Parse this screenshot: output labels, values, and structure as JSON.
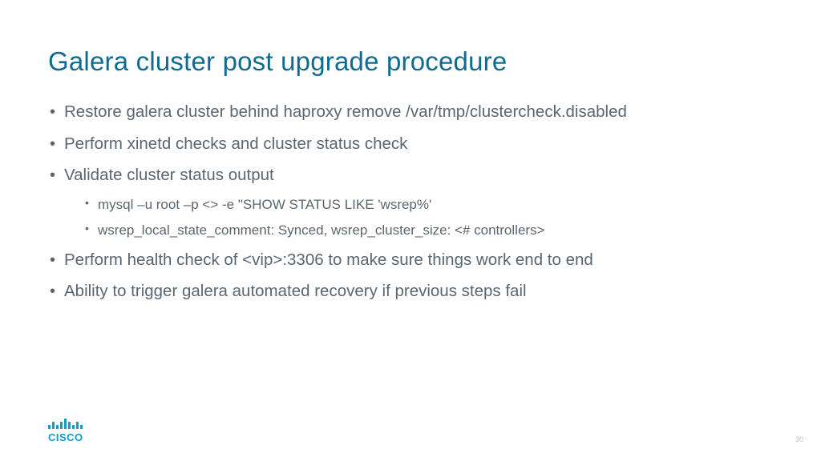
{
  "title": "Galera cluster post upgrade procedure",
  "bullets": {
    "b0": "Restore galera cluster behind haproxy remove /var/tmp/clustercheck.disabled",
    "b1": "Perform xinetd checks and cluster status check",
    "b2": "Validate cluster status output",
    "b2_sub0": "mysql –u root –p <> -e \"SHOW STATUS LIKE 'wsrep%'",
    "b2_sub1": "wsrep_local_state_comment: Synced, wsrep_cluster_size: <# controllers>",
    "b3": "Perform health check of <vip>:3306 to make sure things work end to end",
    "b4": "Ability to trigger galera automated recovery if previous steps fail"
  },
  "logo_text": "CISCO",
  "page_number": "30"
}
